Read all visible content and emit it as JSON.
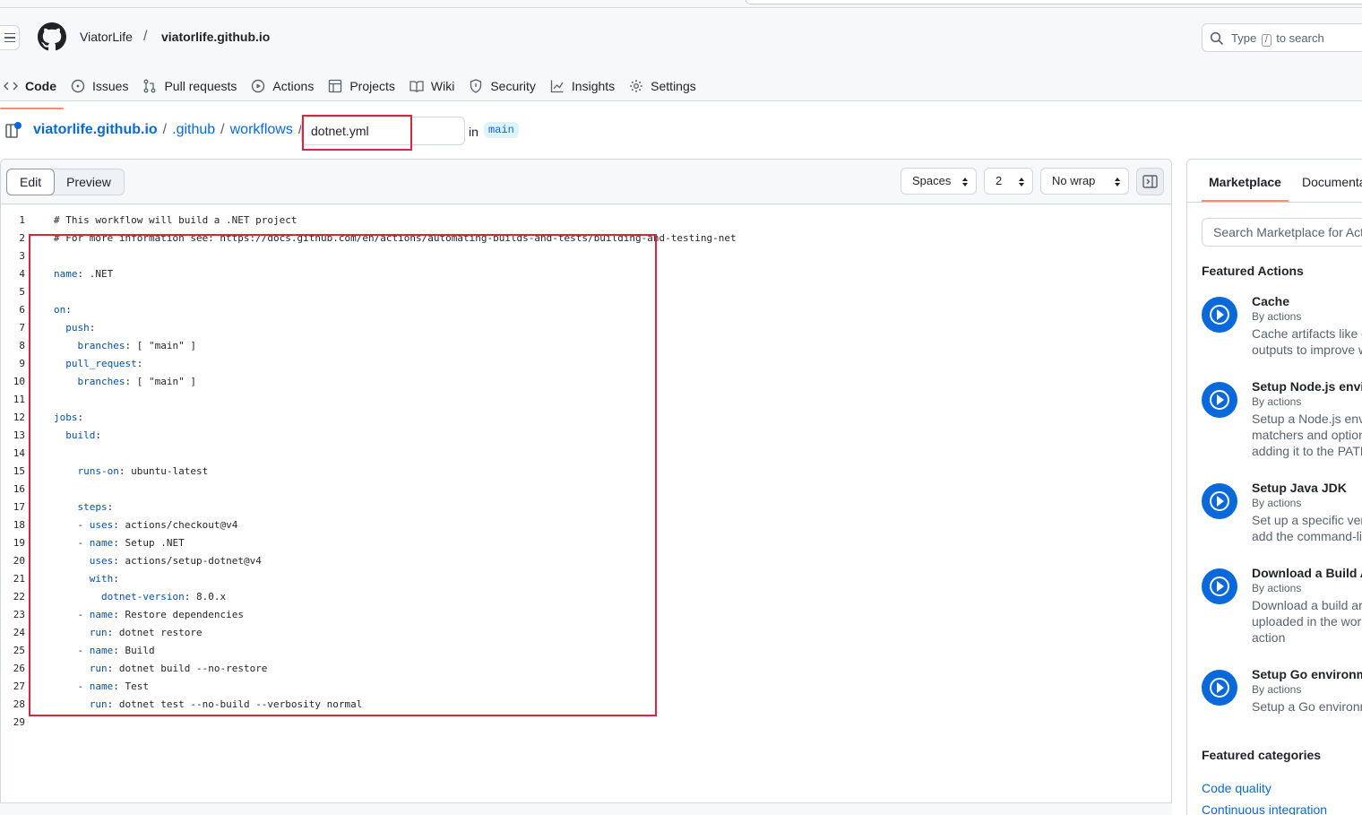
{
  "header": {
    "owner": "ViatorLife",
    "separator": "/",
    "repo": "viatorlife.github.io",
    "search": {
      "prefix": "Type",
      "key": "/",
      "suffix": "to search"
    }
  },
  "tabs": [
    {
      "label": "Code",
      "icon": "code-icon"
    },
    {
      "label": "Issues",
      "icon": "issue-icon"
    },
    {
      "label": "Pull requests",
      "icon": "pull-request-icon"
    },
    {
      "label": "Actions",
      "icon": "play-icon"
    },
    {
      "label": "Projects",
      "icon": "table-icon"
    },
    {
      "label": "Wiki",
      "icon": "book-icon"
    },
    {
      "label": "Security",
      "icon": "shield-icon"
    },
    {
      "label": "Insights",
      "icon": "graph-icon"
    },
    {
      "label": "Settings",
      "icon": "gear-icon"
    }
  ],
  "path": {
    "repo": "viatorlife.github.io",
    "segments": [
      ".github",
      "workflows"
    ],
    "sep": "/",
    "filename": "dotnet.yml",
    "in_label": "in",
    "branch": "main"
  },
  "editor": {
    "mode_tabs": [
      "Edit",
      "Preview"
    ],
    "indent_mode": "Spaces",
    "indent_size": "2",
    "wrap_mode": "No wrap",
    "lines": [
      "# This workflow will build a .NET project",
      "# For more information see: https://docs.github.com/en/actions/automating-builds-and-tests/building-and-testing-net",
      "",
      "name: .NET",
      "",
      "on:",
      "  push:",
      "    branches: [ \"main\" ]",
      "  pull_request:",
      "    branches: [ \"main\" ]",
      "",
      "jobs:",
      "  build:",
      "",
      "    runs-on: ubuntu-latest",
      "",
      "    steps:",
      "    - uses: actions/checkout@v4",
      "    - name: Setup .NET",
      "      uses: actions/setup-dotnet@v4",
      "      with:",
      "        dotnet-version: 8.0.x",
      "    - name: Restore dependencies",
      "      run: dotnet restore",
      "    - name: Build",
      "      run: dotnet build --no-restore",
      "    - name: Test",
      "      run: dotnet test --no-build --verbosity normal",
      ""
    ]
  },
  "sidebar": {
    "tabs": [
      "Marketplace",
      "Documentation"
    ],
    "search_placeholder": "Search Marketplace for Actions",
    "featured_heading": "Featured Actions",
    "actions": [
      {
        "name": "Cache",
        "by": "By actions",
        "desc": [
          "Cache artifacts like dependencies and build",
          "outputs to improve workflow execution time"
        ]
      },
      {
        "name": "Setup Node.js environment",
        "by": "By actions",
        "desc": [
          "Setup a Node.js environment, add problem",
          "matchers and optionally cache npm packages,",
          "adding it to the PATH"
        ]
      },
      {
        "name": "Setup Java JDK",
        "by": "By actions",
        "desc": [
          "Set up a specific version of the Java JDK and",
          "add the command-line tools to the PATH"
        ]
      },
      {
        "name": "Download a Build Artifact",
        "by": "By actions",
        "desc": [
          "Download a build artifact that was previously",
          "uploaded in the workflow by the upload-artifact",
          "action"
        ]
      },
      {
        "name": "Setup Go environment",
        "by": "By actions",
        "desc": [
          "Setup a Go environment and add it to the PATH"
        ]
      }
    ],
    "categories_heading": "Featured categories",
    "categories": [
      "Code quality",
      "Continuous integration"
    ]
  },
  "colors": {
    "accent": "#0969da",
    "tab_underline": "#fd8c73",
    "annotation": "#d7263d"
  }
}
